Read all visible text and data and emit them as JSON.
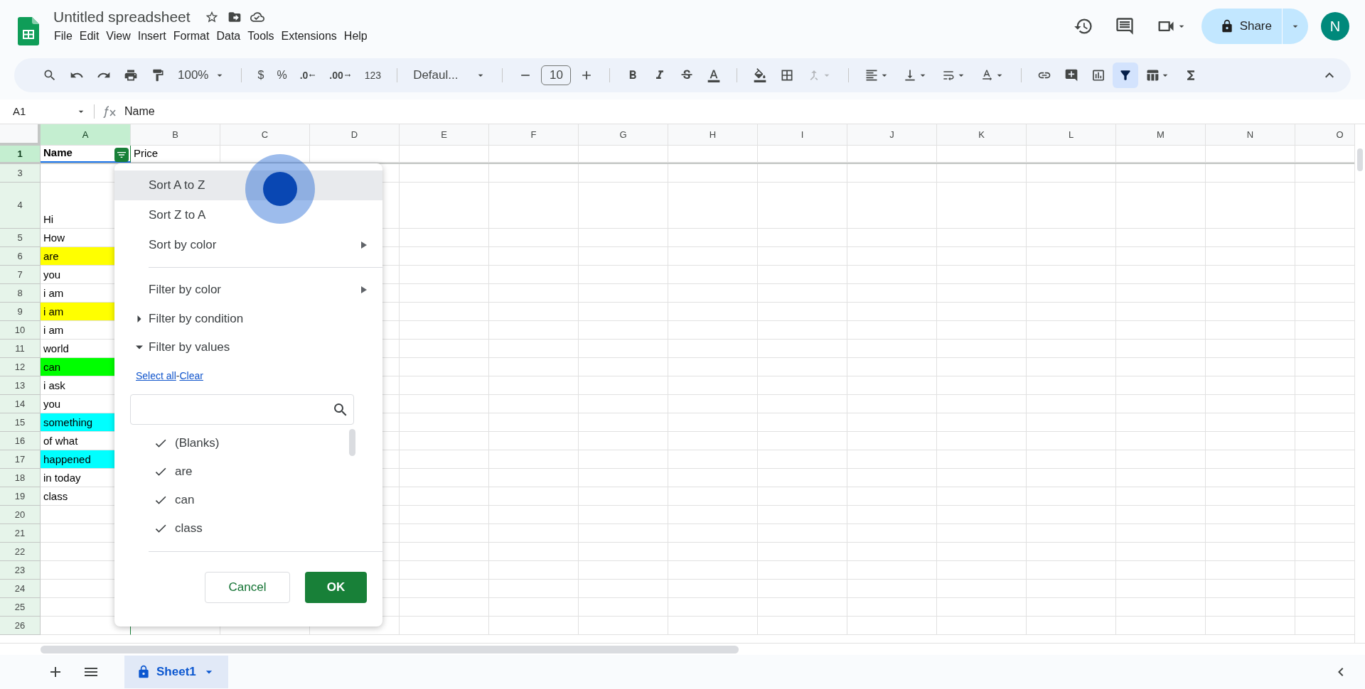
{
  "document": {
    "title": "Untitled spreadsheet"
  },
  "menu_bar": [
    "File",
    "Edit",
    "View",
    "Insert",
    "Format",
    "Data",
    "Tools",
    "Extensions",
    "Help"
  ],
  "toolbar": {
    "zoom": "100%",
    "currency": "$",
    "percent": "%",
    "decrease_decimal": ".0",
    "increase_decimal": ".00",
    "number_format": "123",
    "font": "Defaul...",
    "font_size": "10",
    "filter_on": true
  },
  "share_button": "Share",
  "avatar": "N",
  "name_box": "A1",
  "formula": "Name",
  "columns": [
    {
      "label": "A",
      "selected": true
    },
    {
      "label": "B",
      "selected": false
    },
    {
      "label": "C",
      "selected": false
    },
    {
      "label": "D",
      "selected": false
    },
    {
      "label": "E",
      "selected": false
    },
    {
      "label": "F",
      "selected": false
    },
    {
      "label": "G",
      "selected": false
    },
    {
      "label": "H",
      "selected": false
    },
    {
      "label": "I",
      "selected": false
    },
    {
      "label": "J",
      "selected": false
    },
    {
      "label": "K",
      "selected": false
    },
    {
      "label": "L",
      "selected": false
    },
    {
      "label": "M",
      "selected": false
    },
    {
      "label": "N",
      "selected": false
    },
    {
      "label": "O",
      "selected": false
    }
  ],
  "rows": [
    {
      "number": "1",
      "kind": "header",
      "selected": true,
      "a": "Name",
      "b": "Price"
    },
    {
      "number": "3",
      "kind": "normal",
      "selected": false
    },
    {
      "number": "4",
      "kind": "tall",
      "selected": false,
      "a": "Hi"
    },
    {
      "number": "5",
      "kind": "normal",
      "selected": false,
      "a": "How"
    },
    {
      "number": "6",
      "kind": "normal",
      "selected": false,
      "a": "are",
      "color": "#ffff00"
    },
    {
      "number": "7",
      "kind": "normal",
      "selected": false,
      "a": "you"
    },
    {
      "number": "8",
      "kind": "normal",
      "selected": false,
      "a": "i am"
    },
    {
      "number": "9",
      "kind": "normal",
      "selected": false,
      "a": "i am",
      "color": "#ffff00"
    },
    {
      "number": "10",
      "kind": "normal",
      "selected": false,
      "a": "i am"
    },
    {
      "number": "11",
      "kind": "normal",
      "selected": false,
      "a": "world"
    },
    {
      "number": "12",
      "kind": "normal",
      "selected": false,
      "a": "can",
      "color": "#00ff00"
    },
    {
      "number": "13",
      "kind": "normal",
      "selected": false,
      "a": "i ask"
    },
    {
      "number": "14",
      "kind": "normal",
      "selected": false,
      "a": "you"
    },
    {
      "number": "15",
      "kind": "normal",
      "selected": false,
      "a": "something",
      "color": "#00ffff"
    },
    {
      "number": "16",
      "kind": "normal",
      "selected": false,
      "a": "of what"
    },
    {
      "number": "17",
      "kind": "normal",
      "selected": false,
      "a": "happened",
      "color": "#00ffff"
    },
    {
      "number": "18",
      "kind": "normal",
      "selected": false,
      "a": "in today"
    },
    {
      "number": "19",
      "kind": "normal",
      "selected": false,
      "a": "class"
    },
    {
      "number": "20",
      "kind": "normal",
      "selected": false
    },
    {
      "number": "21",
      "kind": "normal",
      "selected": false
    },
    {
      "number": "22",
      "kind": "normal",
      "selected": false
    },
    {
      "number": "23",
      "kind": "normal",
      "selected": false
    },
    {
      "number": "24",
      "kind": "normal",
      "selected": false
    },
    {
      "number": "25",
      "kind": "normal",
      "selected": false
    },
    {
      "number": "26",
      "kind": "normal",
      "selected": false
    }
  ],
  "filter_menu": {
    "items": [
      {
        "kind": "action",
        "label": "Sort A to Z",
        "highlighted": true
      },
      {
        "kind": "action",
        "label": "Sort Z to A",
        "highlighted": false
      },
      {
        "kind": "submenu",
        "label": "Sort by color",
        "highlighted": false
      },
      {
        "kind": "divider"
      },
      {
        "kind": "submenu",
        "label": "Filter by color",
        "highlighted": false
      },
      {
        "kind": "section",
        "label": "Filter by condition",
        "expanded": false
      },
      {
        "kind": "section",
        "label": "Filter by values",
        "expanded": true
      }
    ],
    "links": [
      "Select all",
      "Clear"
    ],
    "link_separator": "-",
    "values": [
      {
        "label": "(Blanks)",
        "checked": true
      },
      {
        "label": "are",
        "checked": true
      },
      {
        "label": "can",
        "checked": true
      },
      {
        "label": "class",
        "checked": true
      }
    ],
    "cancel": "Cancel",
    "ok": "OK"
  },
  "sheet_tabs": [
    {
      "label": "Sheet1",
      "selected": true,
      "locked": true
    }
  ]
}
